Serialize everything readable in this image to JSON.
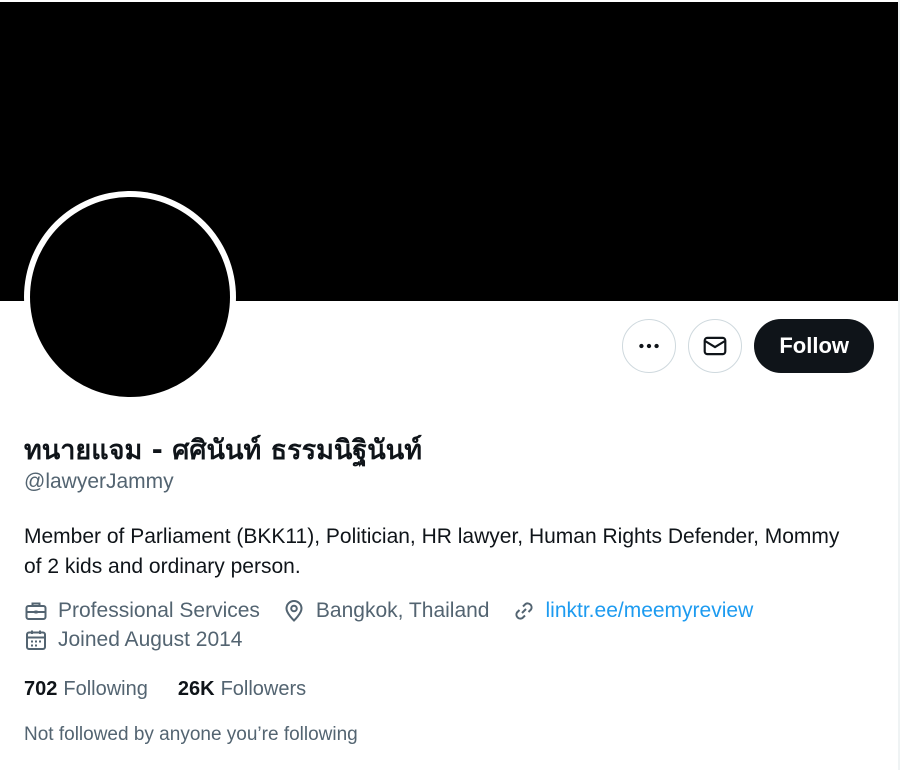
{
  "profile": {
    "display_name": "ทนายแจม - ศศินันท์ ธรรมนิฐินันท์",
    "handle": "@lawyerJammy",
    "bio": "Member of Parliament (BKK11), Politician, HR lawyer, Human Rights Defender, Mommy of 2 kids and ordinary person.",
    "category": "Professional Services",
    "location": "Bangkok, Thailand",
    "website": "linktr.ee/meemyreview",
    "joined": "Joined August 2014"
  },
  "actions": {
    "more_icon": "more-icon",
    "message_icon": "envelope-icon",
    "follow_label": "Follow"
  },
  "stats": {
    "following_count": "702",
    "following_label": "Following",
    "followers_count": "26K",
    "followers_label": "Followers"
  },
  "social_context": "Not followed by anyone you’re following",
  "colors": {
    "accent": "#1d9bf0",
    "text_primary": "#0f1419",
    "text_secondary": "#536471",
    "border": "#cfd9de"
  }
}
